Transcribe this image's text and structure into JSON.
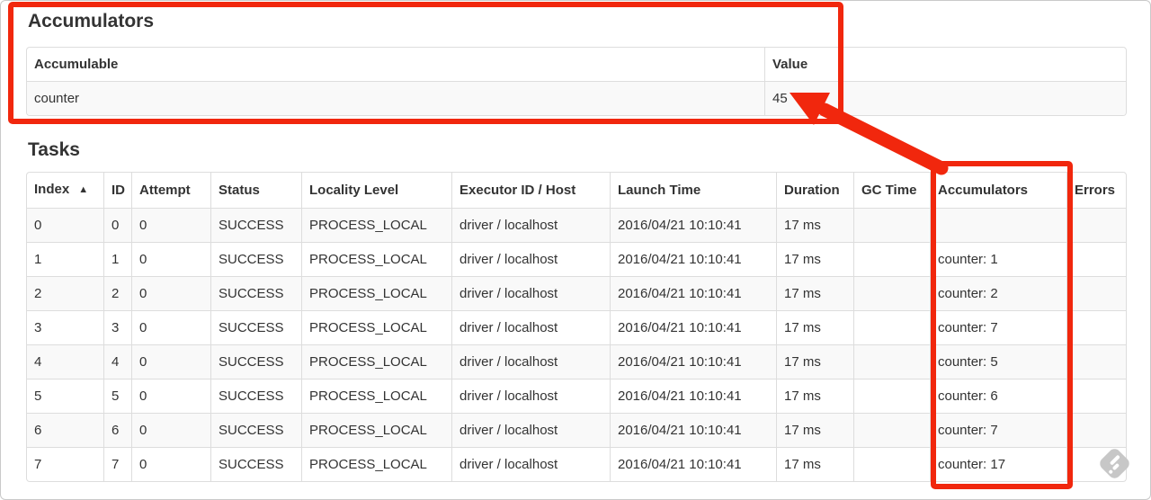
{
  "colors": {
    "annotation_red": "#f1270d",
    "table_border": "#dddddd",
    "row_stripe": "#f9f9f9",
    "text": "#333333",
    "watermark_gray": "#c7c7c7"
  },
  "accumulators_section": {
    "heading": "Accumulators",
    "table": {
      "headers": [
        "Accumulable",
        "Value"
      ],
      "rows": [
        [
          "counter",
          "45"
        ]
      ]
    }
  },
  "tasks_section": {
    "heading": "Tasks",
    "table": {
      "headers": [
        "Index",
        "ID",
        "Attempt",
        "Status",
        "Locality Level",
        "Executor ID / Host",
        "Launch Time",
        "Duration",
        "GC Time",
        "Accumulators",
        "Errors"
      ],
      "sort": {
        "column": "Index",
        "icon": "▲"
      },
      "rows": [
        [
          "0",
          "0",
          "0",
          "SUCCESS",
          "PROCESS_LOCAL",
          "driver / localhost",
          "2016/04/21 10:10:41",
          "17 ms",
          "",
          "",
          ""
        ],
        [
          "1",
          "1",
          "0",
          "SUCCESS",
          "PROCESS_LOCAL",
          "driver / localhost",
          "2016/04/21 10:10:41",
          "17 ms",
          "",
          "counter: 1",
          ""
        ],
        [
          "2",
          "2",
          "0",
          "SUCCESS",
          "PROCESS_LOCAL",
          "driver / localhost",
          "2016/04/21 10:10:41",
          "17 ms",
          "",
          "counter: 2",
          ""
        ],
        [
          "3",
          "3",
          "0",
          "SUCCESS",
          "PROCESS_LOCAL",
          "driver / localhost",
          "2016/04/21 10:10:41",
          "17 ms",
          "",
          "counter: 7",
          ""
        ],
        [
          "4",
          "4",
          "0",
          "SUCCESS",
          "PROCESS_LOCAL",
          "driver / localhost",
          "2016/04/21 10:10:41",
          "17 ms",
          "",
          "counter: 5",
          ""
        ],
        [
          "5",
          "5",
          "0",
          "SUCCESS",
          "PROCESS_LOCAL",
          "driver / localhost",
          "2016/04/21 10:10:41",
          "17 ms",
          "",
          "counter: 6",
          ""
        ],
        [
          "6",
          "6",
          "0",
          "SUCCESS",
          "PROCESS_LOCAL",
          "driver / localhost",
          "2016/04/21 10:10:41",
          "17 ms",
          "",
          "counter: 7",
          ""
        ],
        [
          "7",
          "7",
          "0",
          "SUCCESS",
          "PROCESS_LOCAL",
          "driver / localhost",
          "2016/04/21 10:10:41",
          "17 ms",
          "",
          "counter: 17",
          ""
        ]
      ]
    }
  }
}
